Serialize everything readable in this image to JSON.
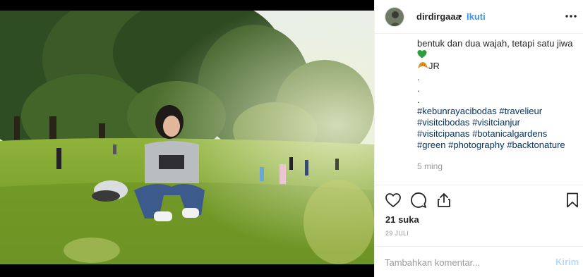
{
  "post": {
    "username": "dirdirgaaa",
    "dot": "•",
    "follow_label": "Ikuti",
    "more_icon": "more-horizontal-icon",
    "avatar_icon": "user-avatar",
    "photo_description_icon": "post-photo"
  },
  "caption": {
    "line1": "bentuk dan dua wajah, tetapi satu jiwa",
    "heart_emoji": "💚",
    "signature_emoji": "🥐",
    "signature": "JR",
    "dot1": ".",
    "dot2": ".",
    "dot3": ".",
    "hashtags_line1": [
      "#kebunrayacibodas",
      "#travelieur"
    ],
    "hashtags_line2": [
      "#visitcibodas",
      "#visitcianjur"
    ],
    "hashtags_line3": [
      "#visitcipanas",
      "#botanicalgardens"
    ],
    "hashtags_line4": [
      "#green",
      "#photography",
      "#backtonature"
    ],
    "time_ago": "5 ming"
  },
  "actions": {
    "like_icon": "heart-icon",
    "comment_icon": "comment-icon",
    "share_icon": "share-icon",
    "save_icon": "bookmark-icon"
  },
  "stats": {
    "likes": "21 suka",
    "date": "29 JULI"
  },
  "comment_box": {
    "placeholder": "Tambahkan komentar...",
    "post_label": "Kirim"
  },
  "colors": {
    "link": "#3897f0",
    "hashtag": "#003569",
    "muted": "#999999",
    "post_disabled": "#b3dbff",
    "heart_emoji": "#2e9e3a"
  }
}
